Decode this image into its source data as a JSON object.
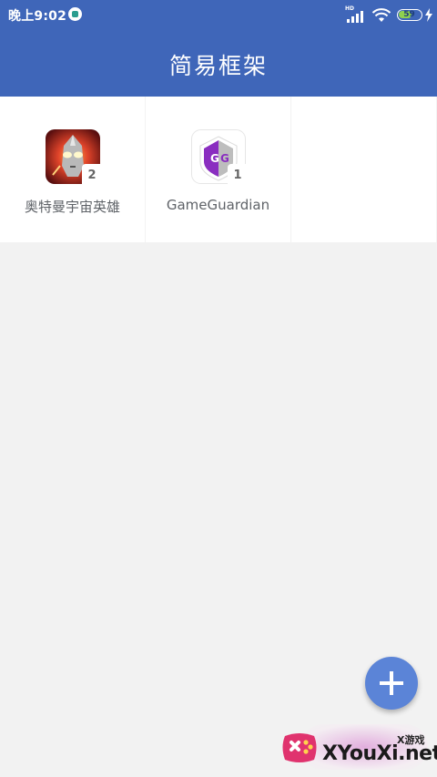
{
  "status_bar": {
    "time": "晚上9:02",
    "hd": "HD",
    "battery": "59"
  },
  "app_bar": {
    "title": "简易框架"
  },
  "apps": [
    {
      "name": "奥特曼宇宙英雄",
      "count": "2",
      "icon": "ultraman-icon"
    },
    {
      "name": "GameGuardian",
      "count": "1",
      "icon": "gameguardian-icon"
    }
  ],
  "fab": {
    "icon": "plus-icon"
  },
  "watermark": {
    "small_text": "X游戏",
    "main_text": "XYouXi.net"
  },
  "colors": {
    "primary": "#3f66b9",
    "fab": "#5b84d7",
    "background": "#f2f2f2"
  }
}
